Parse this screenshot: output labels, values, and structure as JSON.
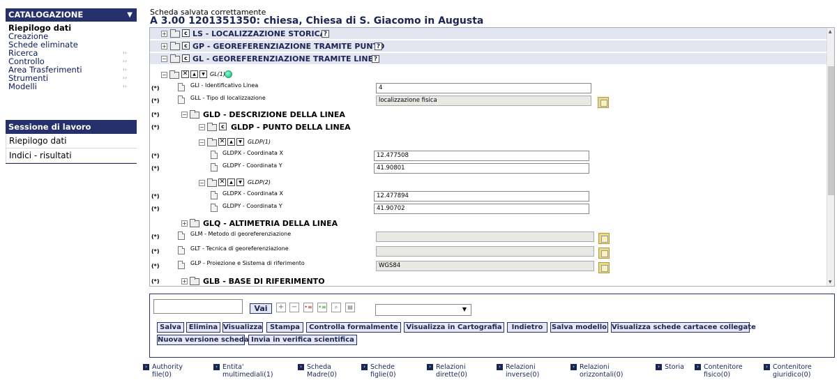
{
  "sidebar": {
    "header": "CATALOGAZIONE",
    "items": [
      {
        "label": "Riepilogo dati",
        "bold": true,
        "more": false
      },
      {
        "label": "Creazione",
        "bold": false,
        "more": false
      },
      {
        "label": "Schede eliminate",
        "bold": false,
        "more": false
      },
      {
        "label": "Ricerca",
        "bold": false,
        "more": true
      },
      {
        "label": "Controllo",
        "bold": false,
        "more": true
      },
      {
        "label": "Area Trasferimenti",
        "bold": false,
        "more": true
      },
      {
        "label": "Strumenti",
        "bold": false,
        "more": true
      },
      {
        "label": "Modelli",
        "bold": false,
        "more": true
      }
    ],
    "more_glyph": "››",
    "session_header": "Sessione di lavoro",
    "session_items": [
      "Riepilogo dati",
      "Indici - risultati"
    ]
  },
  "header": {
    "message": "Scheda salvata correttamente",
    "title": "A 3.00 1201351350: chiesa, Chiesa di S. Giacomo in Augusta"
  },
  "tree": {
    "sections": [
      {
        "label": "LS - LOCALIZZAZIONE STORICA"
      },
      {
        "label": "GP - GEOREFERENZIAZIONE TRAMITE PUNTO"
      },
      {
        "label": "GL - GEOREFERENZIAZIONE TRAMITE LINEA"
      }
    ],
    "occ_gl": "GL(1)",
    "asterisk": "(*)",
    "fields": {
      "gli": {
        "label": "GLI - Identificativo Linea",
        "value": "4"
      },
      "gll": {
        "label": "GLL - Tipo di localizzazione",
        "value": "localizzazione fisica"
      },
      "gld": {
        "label": "GLD - DESCRIZIONE DELLA LINEA"
      },
      "gldp": {
        "label": "GLDP - PUNTO DELLA LINEA"
      },
      "gldp1": {
        "label": "GLDP(1)",
        "x_label": "GLDPX - Coordinata X",
        "x": "12.477508",
        "y_label": "GLDPY - Coordinata Y",
        "y": "41.90801"
      },
      "gldp2": {
        "label": "GLDP(2)",
        "x_label": "GLDPX - Coordinata X",
        "x": "12.477894",
        "y_label": "GLDPY - Coordinata Y",
        "y": "41.90702"
      },
      "glq": {
        "label": "GLQ - ALTIMETRIA DELLA LINEA"
      },
      "glm": {
        "label": "GLM - Metodo di georeferenziazione",
        "value": ""
      },
      "glt": {
        "label": "GLT - Tecnica di georeferenziazione",
        "value": ""
      },
      "glp": {
        "label": "GLP - Proiezione e Sistema di riferimento",
        "value": "WGS84"
      },
      "glb": {
        "label": "GLB - BASE DI RIFERIMENTO"
      }
    }
  },
  "toolbar": {
    "input_value": "",
    "vai": "Vai",
    "select_value": "",
    "buttons_row1": [
      "Salva",
      "Elimina",
      "Visualizza",
      "Stampa",
      "Controlla formalmente",
      "Visualizza in Cartografia",
      "Indietro",
      "Salva modello",
      "Visualizza schede cartacee collegate"
    ],
    "buttons_row2": [
      "Nuova versione scheda",
      "Invia in verifica scientifica"
    ]
  },
  "footer": [
    {
      "line1": "Authority",
      "line2": "file(0)"
    },
    {
      "line1": "Entita'",
      "line2": "multimediali(1)"
    },
    {
      "line1": "Scheda",
      "line2": "Madre(0)"
    },
    {
      "line1": "Schede",
      "line2": "figlie(0)"
    },
    {
      "line1": "Relazioni",
      "line2": "dirette(0)"
    },
    {
      "line1": "Relazioni",
      "line2": "inverse(0)"
    },
    {
      "line1": "Relazioni",
      "line2": "orizzontali(0)"
    },
    {
      "line1": "Storia",
      "line2": ""
    },
    {
      "line1": "Contenitore",
      "line2": "fisico(0)"
    },
    {
      "line1": "Contenitore",
      "line2": "giuridico(0)"
    }
  ],
  "colors": {
    "accent": "#26316b",
    "section_bg": "#e3e6f0"
  }
}
